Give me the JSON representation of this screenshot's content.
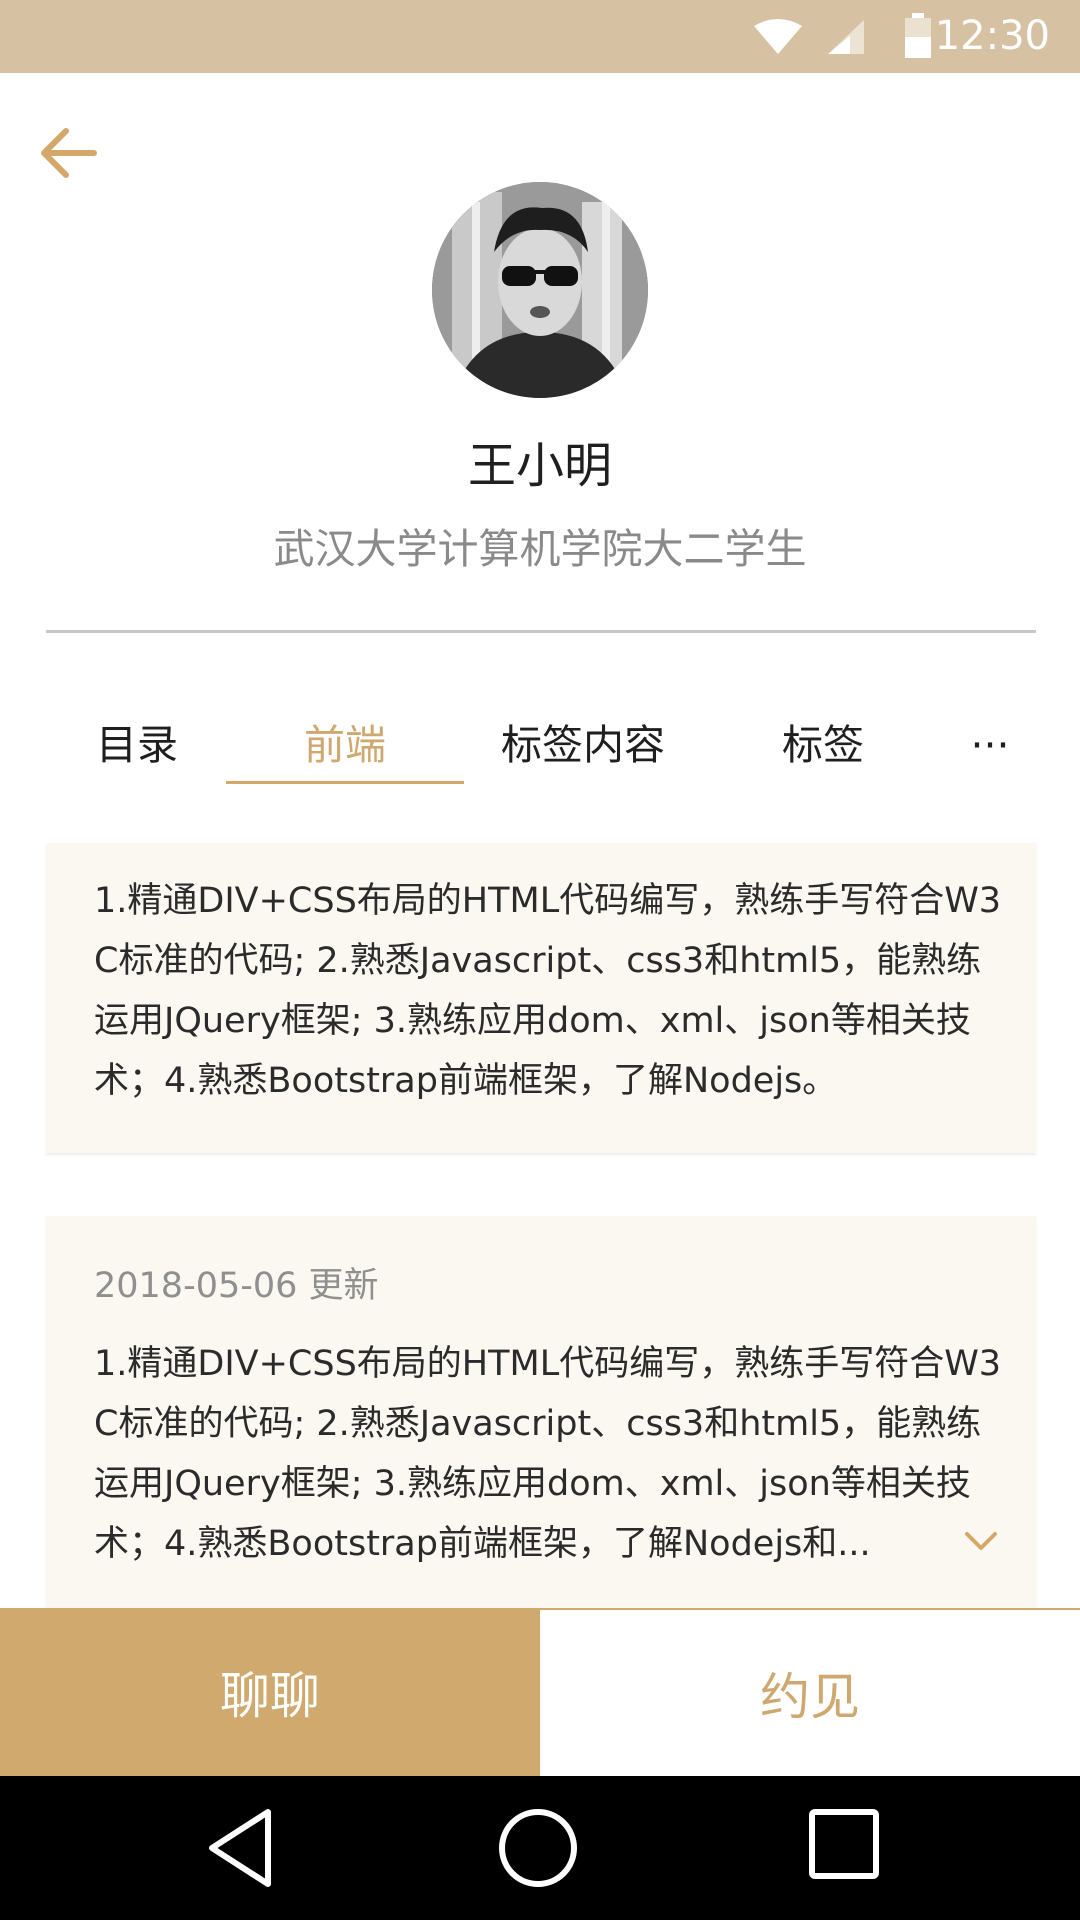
{
  "status_bar": {
    "time": "12:30"
  },
  "profile": {
    "name": "王小明",
    "description": "武汉大学计算机学院大二学生"
  },
  "tabs": [
    {
      "label": "目录"
    },
    {
      "label": "前端"
    },
    {
      "label": "标签内容"
    },
    {
      "label": "标签"
    },
    {
      "label": "···"
    }
  ],
  "cards": [
    {
      "text": "1.精通DIV+CSS布局的HTML代码编写，熟练手写符合W3C标准的代码; 2.熟悉Javascript、css3和html5，能熟练运用JQuery框架; 3.熟练应用dom、xml、json等相关技术；4.熟悉Bootstrap前端框架，了解Nodejs。"
    },
    {
      "date": "2018-05-06 更新",
      "text": "1.精通DIV+CSS布局的HTML代码编写，熟练手写符合W3C标准的代码; 2.熟悉Javascript、css3和html5，能熟练运用JQuery框架; 3.熟练应用dom、xml、json等相关技术；4.熟悉Bootstrap前端框架，了解Nodejs和..."
    }
  ],
  "actions": {
    "chat": "聊聊",
    "meet": "约见"
  },
  "colors": {
    "accent": "#d0a96f",
    "status_bar": "#d6c2a3",
    "card_bg": "#fbf8f1"
  },
  "icons": [
    "wifi-icon",
    "signal-icon",
    "battery-icon",
    "back-arrow-icon",
    "chevron-down-icon",
    "nav-back-icon",
    "nav-home-icon",
    "nav-recents-icon"
  ]
}
